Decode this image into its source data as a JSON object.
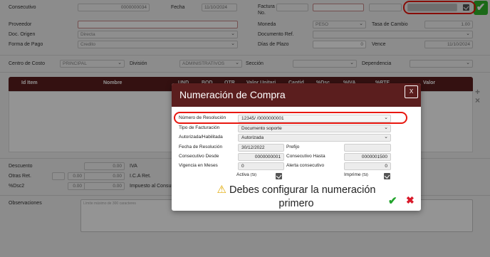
{
  "header": {
    "consecutivo_label": "Consecutivo",
    "consecutivo_value": "0000000034",
    "fecha_label": "Fecha",
    "fecha_value": "11/10/2024",
    "factura_label": "Factura",
    "factura_label2": "No.",
    "proveedor_label": "Proveedor",
    "moneda_label": "Moneda",
    "moneda_value": "PESO",
    "tasa_label": "Tasa de Cambio",
    "tasa_value": "1.00",
    "doc_origen_label": "Doc. Origen",
    "doc_origen_value": "Directa",
    "documento_ref_label": "Documento Ref.",
    "forma_pago_label": "Forma de Pago",
    "forma_pago_value": "Credito",
    "dias_plazo_label": "Días de Plazo",
    "dias_plazo_value": "0",
    "vence_label": "Vence",
    "vence_value": "11/10/2024"
  },
  "filters": {
    "centro_costo_label": "Centro de Costo",
    "centro_costo_value": "PRINCIPAL",
    "division_label": "División",
    "division_value": "ADMINISTRATIVOS",
    "seccion_label": "Sección",
    "dependencia_label": "Dependencia"
  },
  "grid": {
    "columns": [
      "Id Item",
      "Nombre",
      "UND",
      "BOD",
      "OTR",
      "Valor Unitari",
      "Cantid",
      "%Dsc",
      "%IVA",
      "%RTE",
      "Valor"
    ]
  },
  "totals": {
    "descuento_label": "Descuento",
    "descuento_value": "0.00",
    "iva_label": "IVA",
    "otras_ret_label": "Otras Ret.",
    "otras_ret_value1": "0.00",
    "otras_ret_value2": "0.00",
    "ica_label": "I.C.A Ret.",
    "dsc2_label": "%Dsc2",
    "dsc2_value1": "0.00",
    "dsc2_value2": "0.00",
    "impuesto_consumo_label": "Impuesto al Consumo"
  },
  "observaciones": {
    "label": "Observaciones",
    "placeholder": "Límite máximo de 300 caracteres"
  },
  "modal": {
    "title": "Numeración de Compra",
    "close_label": "X",
    "resolucion_label": "Número de Resolución",
    "resolucion_value": "12345/ /0000000001",
    "tipo_facturacion_label": "Tipo de Facturación",
    "tipo_facturacion_value": "Documento soporte",
    "autorizada_label": "Autorizada/Habilitada",
    "autorizada_value": "Autorizada",
    "fecha_resolucion_label": "Fecha de Resolución",
    "fecha_resolucion_value": "30/12/2022",
    "prefijo_label": "Prefijo",
    "consecutivo_desde_label": "Consecutivo Desde",
    "consecutivo_desde_value": "0000000001",
    "consecutivo_hasta_label": "Consecutivo Hasta",
    "consecutivo_hasta_value": "0000001500",
    "vigencia_label": "Vigencia en Meses",
    "vigencia_value": "0",
    "alerta_label": "Alerta consecutivo",
    "alerta_value": "0",
    "activa_label": "Activa",
    "activa_suffix": "(Si)",
    "imprime_label": "Imprime",
    "imprime_suffix": "(Si)",
    "warning_line1": "Debes configurar la numeración",
    "warning_line2": "primero"
  },
  "icons": {
    "warning": "⚠",
    "ok": "✔",
    "cancel": "✖",
    "add": "+",
    "remove": "×"
  },
  "colors": {
    "brand": "#5b1e1e",
    "highlight": "#e8170f",
    "ok": "#21a32b",
    "cancel": "#d9192a"
  }
}
